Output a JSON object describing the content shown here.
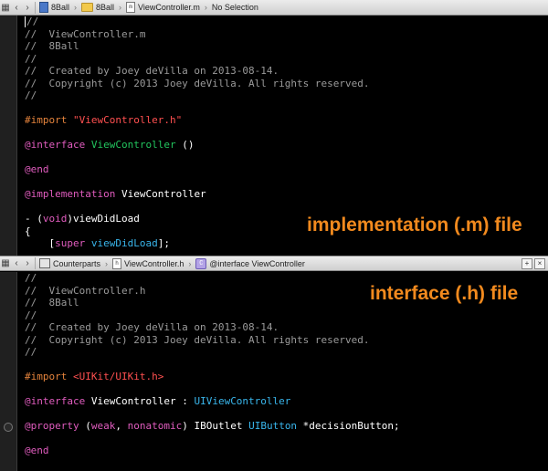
{
  "top_jumpbar": {
    "crumbs": [
      "8Ball",
      "8Ball",
      "ViewController.m",
      "No Selection"
    ]
  },
  "bottom_jumpbar": {
    "crumbs": [
      "Counterparts",
      "ViewController.h",
      "@interface ViewController"
    ]
  },
  "top_editor": {
    "lines": [
      [
        {
          "t": "//",
          "c": "cmt"
        }
      ],
      [
        {
          "t": "//  ViewController.m",
          "c": "cmt"
        }
      ],
      [
        {
          "t": "//  8Ball",
          "c": "cmt"
        }
      ],
      [
        {
          "t": "//",
          "c": "cmt"
        }
      ],
      [
        {
          "t": "//  Created by Joey deVilla on 2013-08-14.",
          "c": "cmt"
        }
      ],
      [
        {
          "t": "//  Copyright (c) 2013 Joey deVilla. All rights reserved.",
          "c": "cmt"
        }
      ],
      [
        {
          "t": "//",
          "c": "cmt"
        }
      ],
      [],
      [
        {
          "t": "#import ",
          "c": "pp"
        },
        {
          "t": "\"ViewController.h\"",
          "c": "str"
        }
      ],
      [],
      [
        {
          "t": "@interface ",
          "c": "kw"
        },
        {
          "t": "ViewController",
          "c": "cls"
        },
        {
          "t": " ()",
          "c": "txt"
        }
      ],
      [],
      [
        {
          "t": "@end",
          "c": "kw"
        }
      ],
      [],
      [
        {
          "t": "@implementation ",
          "c": "kw"
        },
        {
          "t": "ViewController",
          "c": "txt"
        }
      ],
      [],
      [
        {
          "t": "- (",
          "c": "txt"
        },
        {
          "t": "void",
          "c": "kw"
        },
        {
          "t": ")viewDidLoad",
          "c": "txt"
        }
      ],
      [
        {
          "t": "{",
          "c": "txt"
        }
      ],
      [
        {
          "t": "    [",
          "c": "txt"
        },
        {
          "t": "super",
          "c": "kw"
        },
        {
          "t": " ",
          "c": "txt"
        },
        {
          "t": "viewDidLoad",
          "c": "type"
        },
        {
          "t": "];",
          "c": "txt"
        }
      ]
    ]
  },
  "bottom_editor": {
    "lines": [
      [
        {
          "t": "//",
          "c": "cmt"
        }
      ],
      [
        {
          "t": "//  ViewController.h",
          "c": "cmt"
        }
      ],
      [
        {
          "t": "//  8Ball",
          "c": "cmt"
        }
      ],
      [
        {
          "t": "//",
          "c": "cmt"
        }
      ],
      [
        {
          "t": "//  Created by Joey deVilla on 2013-08-14.",
          "c": "cmt"
        }
      ],
      [
        {
          "t": "//  Copyright (c) 2013 Joey deVilla. All rights reserved.",
          "c": "cmt"
        }
      ],
      [
        {
          "t": "//",
          "c": "cmt"
        }
      ],
      [],
      [
        {
          "t": "#import ",
          "c": "pp"
        },
        {
          "t": "<UIKit/UIKit.h>",
          "c": "str"
        }
      ],
      [],
      [
        {
          "t": "@interface ",
          "c": "kw"
        },
        {
          "t": "ViewController",
          "c": "txt"
        },
        {
          "t": " : ",
          "c": "txt"
        },
        {
          "t": "UIViewController",
          "c": "type"
        }
      ],
      [],
      [
        {
          "t": "@property ",
          "c": "kw"
        },
        {
          "t": "(",
          "c": "txt"
        },
        {
          "t": "weak",
          "c": "kw"
        },
        {
          "t": ", ",
          "c": "txt"
        },
        {
          "t": "nonatomic",
          "c": "kw"
        },
        {
          "t": ") IBOutlet ",
          "c": "txt"
        },
        {
          "t": "UIButton",
          "c": "type"
        },
        {
          "t": " *decisionButton;",
          "c": "txt"
        }
      ],
      [],
      [
        {
          "t": "@end",
          "c": "kw"
        }
      ]
    ]
  },
  "labels": {
    "implementation": "implementation (.m) file",
    "interface": "interface (.h) file"
  },
  "colors": {
    "comment": "#9a9a9a",
    "preprocessor": "#e4833c",
    "string": "#ff5050",
    "keyword": "#e05cbe",
    "class_name": "#22c55e",
    "type": "#39b6ec",
    "label": "#f28a1e"
  }
}
